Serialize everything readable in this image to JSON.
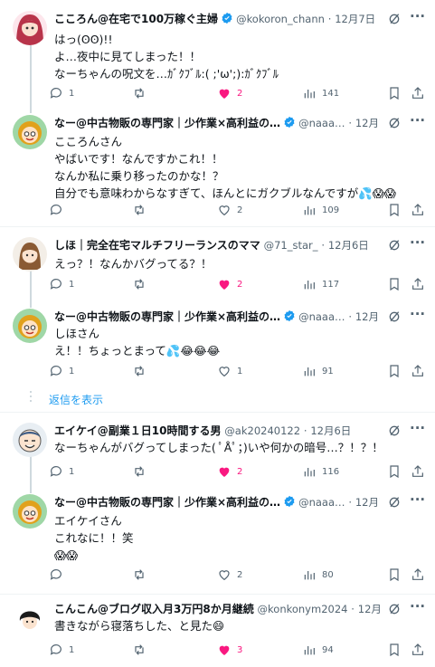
{
  "colors": {
    "accent": "#1d9bf0",
    "like": "#f91880",
    "muted": "#536471",
    "text": "#0f1419",
    "divider": "#eff3f4"
  },
  "tweets": [
    {
      "name": "こころん@在宅で100万稼ぐ主婦",
      "verified": true,
      "handle": "@kokoron_chann",
      "dot": "·",
      "time": "12月7日",
      "text": "はっ(ʘʘ)!!\nよ…夜中に見てしまった！！\nなーちゃんの呪文を…ｶﾞｸﾌﾞﾙ:( ;'ω';):ｶﾞｸﾌﾞﾙ",
      "replies": "1",
      "retweets": "",
      "likes": "2",
      "liked": true,
      "views": "141",
      "avatar": "woman-red-hair-avatar"
    },
    {
      "name": "なー@中古物販の専門家｜少作業×高利益の…",
      "verified": true,
      "handle": "@naaa…",
      "dot": "·",
      "time": "12月7日",
      "text": "こころんさん\nやばいです！なんですかこれ！！\nなんか私に乗り移ったのかな！？\n自分でも意味わからなすぎて、ほんとにガクブルなんですが💦😱😱",
      "replies": "",
      "retweets": "",
      "likes": "2",
      "liked": false,
      "views": "109",
      "avatar": "cartoon-girl-avatar"
    },
    {
      "name": "しほ｜完全在宅マルチフリーランスのママ",
      "verified": false,
      "handle": "@71_star_",
      "dot": "·",
      "time": "12月6日",
      "text": "えっ？！なんかバグってる？！",
      "replies": "1",
      "retweets": "",
      "likes": "2",
      "liked": true,
      "views": "117",
      "avatar": "woman-brown-hair-avatar"
    },
    {
      "name": "なー@中古物販の専門家｜少作業×高利益の…",
      "verified": true,
      "handle": "@naaa…",
      "dot": "·",
      "time": "12月7日",
      "text": "しほさん\nえ！！ちょっとまって💦😂😂😂",
      "replies": "1",
      "retweets": "",
      "likes": "1",
      "liked": false,
      "views": "91",
      "avatar": "cartoon-girl-avatar"
    },
    {
      "name": "エイケイ@副業１日10時間する男",
      "verified": false,
      "handle": "@ak20240122",
      "dot": "·",
      "time": "12月6日",
      "text": "なーちゃんがバグってしまった( ﾟÅﾟ；)いや何かの暗号…？！？！",
      "replies": "1",
      "retweets": "",
      "likes": "2",
      "liked": true,
      "views": "116",
      "avatar": "man-cartoon-avatar"
    },
    {
      "name": "なー@中古物販の専門家｜少作業×高利益の…",
      "verified": true,
      "handle": "@naaa…",
      "dot": "·",
      "time": "12月7日",
      "text": "エイケイさん\nこれなに！！笑\n😱😱",
      "replies": "",
      "retweets": "",
      "likes": "2",
      "liked": false,
      "views": "80",
      "avatar": "cartoon-girl-avatar"
    },
    {
      "name": "こんこん@ブログ収入月3万円8か月継続",
      "verified": false,
      "handle": "@konkonym2024",
      "dot": "·",
      "time": "12月7日",
      "text": "書きながら寝落ちした、と見た😄",
      "replies": "1",
      "retweets": "",
      "likes": "3",
      "liked": true,
      "views": "94",
      "avatar": "black-hair-boy-avatar"
    }
  ],
  "show_replies": "返信を表示"
}
